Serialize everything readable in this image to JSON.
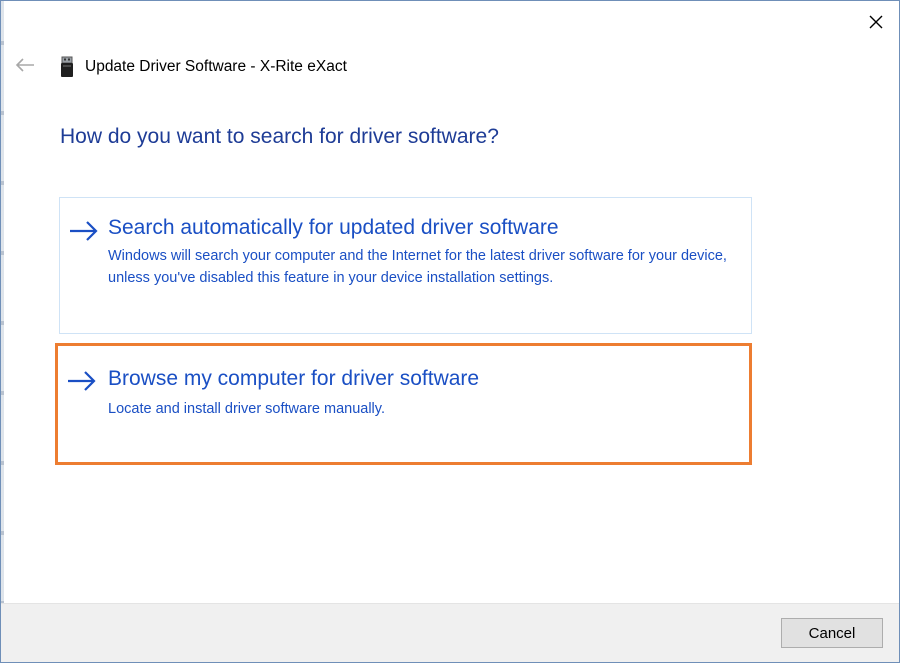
{
  "window": {
    "title": "Update Driver Software - X-Rite eXact",
    "close_icon": "close-icon",
    "back_icon": "back-arrow-icon",
    "device_icon": "usb-device-icon"
  },
  "main": {
    "heading": "How do you want to search for driver software?",
    "options": [
      {
        "icon": "arrow-right-icon",
        "title": "Search automatically for updated driver software",
        "description": "Windows will search your computer and the Internet for the latest driver software for your device, unless you've disabled this feature in your device installation settings."
      },
      {
        "icon": "arrow-right-icon",
        "title": "Browse my computer for driver software",
        "description": "Locate and install driver software manually.",
        "highlighted": true,
        "highlight_color": "#ed7d31"
      }
    ]
  },
  "footer": {
    "cancel_label": "Cancel"
  },
  "colors": {
    "heading": "#1e3c96",
    "link": "#1a4fc4",
    "highlight": "#ed7d31",
    "option_border": "#cfe3f6",
    "footer_bg": "#f0f0f0"
  }
}
